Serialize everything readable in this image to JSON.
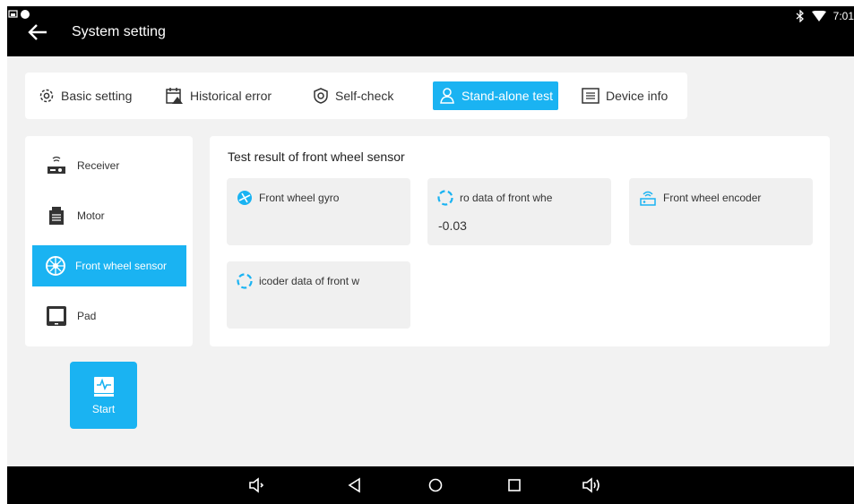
{
  "header": {
    "title": "System setting",
    "time": "7:01"
  },
  "tabs": [
    {
      "label": "Basic setting",
      "icon": "gear-icon"
    },
    {
      "label": "Historical error",
      "icon": "calendar-warning-icon"
    },
    {
      "label": "Self-check",
      "icon": "shield-check-icon"
    },
    {
      "label": "Stand-alone test",
      "icon": "person-icon",
      "active": true
    },
    {
      "label": "Device info",
      "icon": "info-list-icon"
    }
  ],
  "sidebar": {
    "items": [
      {
        "label": "Receiver",
        "icon": "receiver-icon"
      },
      {
        "label": "Motor",
        "icon": "motor-icon"
      },
      {
        "label": "Front wheel sensor",
        "icon": "wheel-icon",
        "active": true
      },
      {
        "label": "Pad",
        "icon": "pad-icon"
      }
    ]
  },
  "main": {
    "title": "Test result of front wheel sensor",
    "cards": [
      {
        "label": "Front wheel gyro",
        "value": "",
        "icon": "gyro-icon"
      },
      {
        "label": "ro data of front whe",
        "value": "-0.03",
        "icon": "loading-ring-icon"
      },
      {
        "label": "Front wheel encoder",
        "value": "",
        "icon": "encoder-icon"
      },
      {
        "label": "icoder data of front w",
        "value": "",
        "icon": "loading-ring-icon"
      }
    ]
  },
  "start": {
    "label": "Start"
  },
  "colors": {
    "accent": "#1ab3f2",
    "background": "#f2f2f2",
    "bar": "#000000"
  }
}
